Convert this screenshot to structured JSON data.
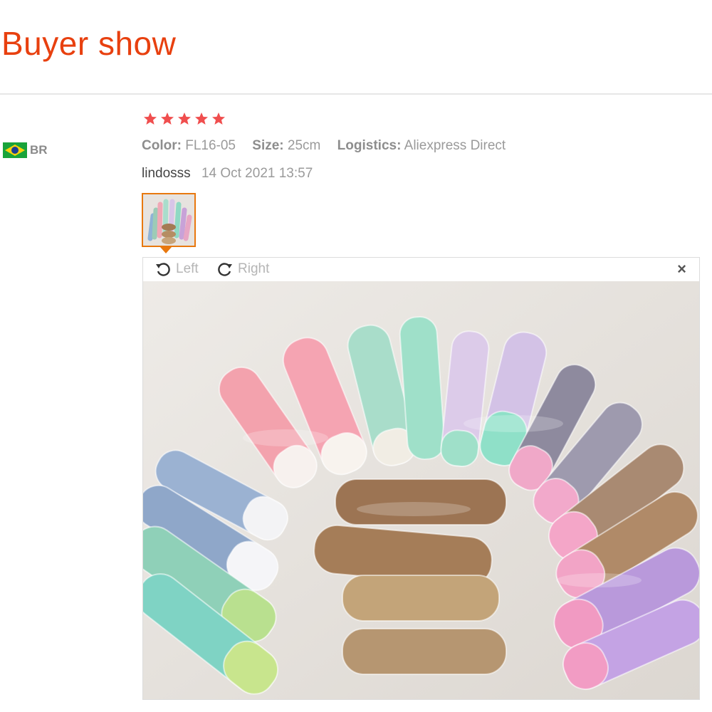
{
  "header": {
    "title": "Buyer show"
  },
  "review": {
    "country_code": "BR",
    "rating": 5,
    "color_label": "Color:",
    "color_value": "FL16-05",
    "size_label": "Size:",
    "size_value": "25cm",
    "logistics_label": "Logistics:",
    "logistics_value": "Aliexpress Direct",
    "author": "lindosss",
    "date": "14 Oct 2021 13:57"
  },
  "viewer": {
    "rotate_left_label": "Left",
    "rotate_right_label": "Right",
    "close_glyph": "×"
  },
  "colors": {
    "title": "#e8400f",
    "star": "#f04e4e",
    "thumb_border": "#e8780f"
  },
  "icons": [
    "brazil-flag-icon",
    "star-icon",
    "rotate-left-icon",
    "rotate-right-icon",
    "close-icon"
  ]
}
